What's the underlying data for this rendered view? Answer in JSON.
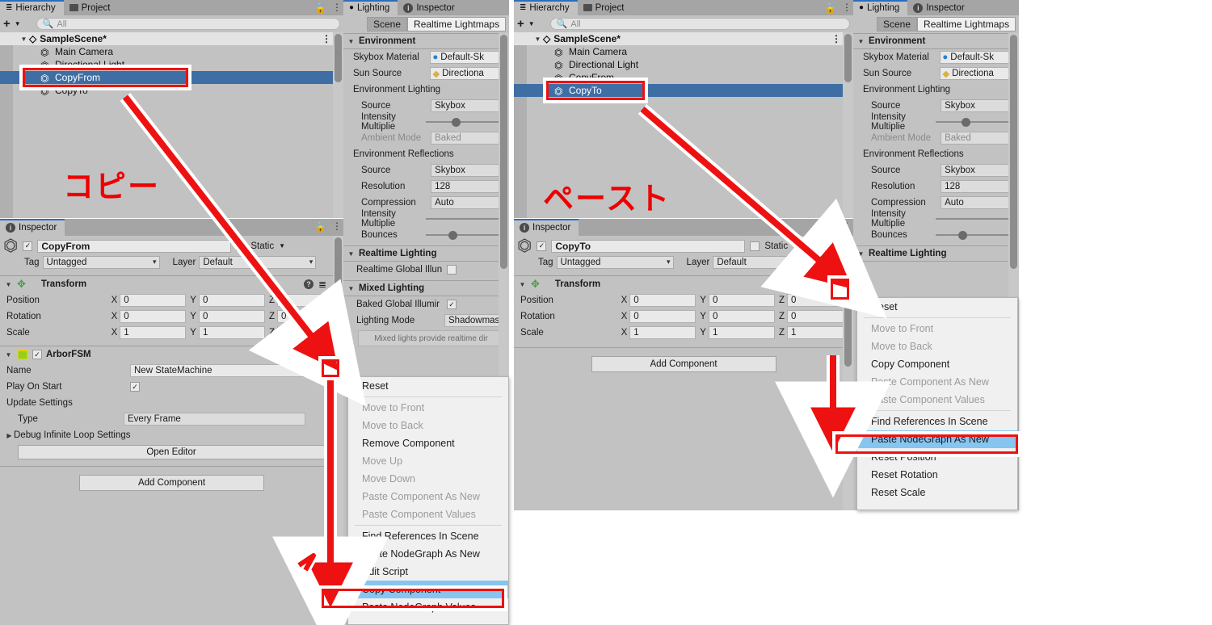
{
  "annotations": {
    "copy_label": "コピー",
    "paste_label": "ペースト",
    "accent_red": "#ee1111",
    "highlight_blue": "#86c5f0",
    "selection_blue": "#3f6ea5"
  },
  "left": {
    "hierarchy": {
      "tabs": [
        {
          "label": "Hierarchy",
          "icon": "hierarchy-icon",
          "active": true
        },
        {
          "label": "Project",
          "icon": "folder-icon",
          "active": false
        }
      ],
      "create_label": "+",
      "search_placeholder": "All",
      "search_value": "",
      "scene": "SampleScene*",
      "items": [
        {
          "label": "Main Camera",
          "selected": false
        },
        {
          "label": "Directional Light",
          "selected": false
        },
        {
          "label": "CopyFrom",
          "selected": true
        },
        {
          "label": "CopyTo",
          "selected": false
        }
      ]
    },
    "inspector": {
      "tab_label": "Inspector",
      "object_name": "CopyFrom",
      "enabled": true,
      "static_label": "Static",
      "tag_label": "Tag",
      "tag_value": "Untagged",
      "layer_label": "Layer",
      "layer_value": "Default",
      "transform": {
        "title": "Transform",
        "rows": [
          {
            "label": "Position",
            "x": "0",
            "y": "0",
            "z": "0"
          },
          {
            "label": "Rotation",
            "x": "0",
            "y": "0",
            "z": "0"
          },
          {
            "label": "Scale",
            "x": "1",
            "y": "1",
            "z": "1"
          }
        ]
      },
      "arborfsm": {
        "title": "ArborFSM",
        "enabled": true,
        "name_label": "Name",
        "name_value": "New StateMachine",
        "play_on_start_label": "Play On Start",
        "play_on_start": true,
        "update_settings_label": "Update Settings",
        "type_label": "Type",
        "type_value": "Every Frame",
        "debug_label": "Debug Infinite Loop Settings",
        "open_editor_label": "Open Editor"
      },
      "add_component_label": "Add Component"
    },
    "lighting": {
      "tabs": [
        {
          "label": "Lighting",
          "icon": "bulb-icon",
          "active": true
        },
        {
          "label": "Inspector",
          "icon": "info-icon",
          "active": false
        }
      ],
      "subtabs": [
        {
          "label": "Scene",
          "active": true
        },
        {
          "label": "Realtime Lightmaps",
          "active": false
        }
      ],
      "environment": {
        "title": "Environment",
        "skybox_material_label": "Skybox Material",
        "skybox_material_value": "Default-Sk",
        "sun_source_label": "Sun Source",
        "sun_source_value": "Directiona",
        "env_lighting_label": "Environment Lighting",
        "source_label": "Source",
        "source_value": "Skybox",
        "intensity_label": "Intensity Multiplie",
        "ambient_mode_label": "Ambient Mode",
        "ambient_mode_value": "Baked",
        "env_reflections_label": "Environment Reflections",
        "refl_source_label": "Source",
        "refl_source_value": "Skybox",
        "resolution_label": "Resolution",
        "resolution_value": "128",
        "compression_label": "Compression",
        "compression_value": "Auto",
        "refl_intensity_label": "Intensity Multiplie",
        "bounces_label": "Bounces"
      },
      "realtime": {
        "title": "Realtime Lighting",
        "rtgi_label": "Realtime Global Illun",
        "rtgi_checked": false
      },
      "mixed": {
        "title": "Mixed Lighting",
        "bgi_label": "Baked Global Illumir",
        "bgi_checked": true,
        "mode_label": "Lighting Mode",
        "mode_value": "Shadowmas",
        "help_text": "Mixed lights provide realtime dir"
      }
    },
    "context_menu": {
      "items": [
        {
          "label": "Reset",
          "state": "enabled"
        },
        {
          "label": "",
          "state": "separator"
        },
        {
          "label": "Move to Front",
          "state": "disabled"
        },
        {
          "label": "Move to Back",
          "state": "disabled"
        },
        {
          "label": "Remove Component",
          "state": "enabled"
        },
        {
          "label": "Move Up",
          "state": "disabled"
        },
        {
          "label": "Move Down",
          "state": "disabled"
        },
        {
          "label": "Paste Component As New",
          "state": "disabled"
        },
        {
          "label": "Paste Component Values",
          "state": "disabled"
        },
        {
          "label": "",
          "state": "separator"
        },
        {
          "label": "Find References In Scene",
          "state": "enabled"
        },
        {
          "label": "Paste NodeGraph As New",
          "state": "enabled"
        },
        {
          "label": "Edit Script",
          "state": "enabled"
        },
        {
          "label": "Copy Component",
          "state": "highlighted"
        },
        {
          "label": "Paste NodeGraph Values",
          "state": "enabled"
        }
      ]
    }
  },
  "right": {
    "hierarchy": {
      "tabs": [
        {
          "label": "Hierarchy",
          "icon": "hierarchy-icon",
          "active": true
        },
        {
          "label": "Project",
          "icon": "folder-icon",
          "active": false
        }
      ],
      "create_label": "+",
      "search_placeholder": "All",
      "search_value": "",
      "scene": "SampleScene*",
      "items": [
        {
          "label": "Main Camera",
          "selected": false
        },
        {
          "label": "Directional Light",
          "selected": false
        },
        {
          "label": "CopyFrom",
          "selected": false
        },
        {
          "label": "CopyTo",
          "selected": true
        }
      ]
    },
    "inspector": {
      "tab_label": "Inspector",
      "object_name": "CopyTo",
      "enabled": true,
      "static_label": "Static",
      "tag_label": "Tag",
      "tag_value": "Untagged",
      "layer_label": "Layer",
      "layer_value": "Default",
      "transform": {
        "title": "Transform",
        "rows": [
          {
            "label": "Position",
            "x": "0",
            "y": "0",
            "z": "0"
          },
          {
            "label": "Rotation",
            "x": "0",
            "y": "0",
            "z": "0"
          },
          {
            "label": "Scale",
            "x": "1",
            "y": "1",
            "z": "1"
          }
        ]
      },
      "add_component_label": "Add Component"
    },
    "lighting": {
      "tabs": [
        {
          "label": "Lighting",
          "icon": "bulb-icon",
          "active": true
        },
        {
          "label": "Inspector",
          "icon": "info-icon",
          "active": false
        }
      ],
      "subtabs": [
        {
          "label": "Scene",
          "active": true
        },
        {
          "label": "Realtime Lightmaps",
          "active": false
        }
      ],
      "environment": {
        "title": "Environment",
        "skybox_material_label": "Skybox Material",
        "skybox_material_value": "Default-Sk",
        "sun_source_label": "Sun Source",
        "sun_source_value": "Directiona",
        "env_lighting_label": "Environment Lighting",
        "source_label": "Source",
        "source_value": "Skybox",
        "intensity_label": "Intensity Multiplie",
        "ambient_mode_label": "Ambient Mode",
        "ambient_mode_value": "Baked",
        "env_reflections_label": "Environment Reflections",
        "refl_source_label": "Source",
        "refl_source_value": "Skybox",
        "resolution_label": "Resolution",
        "resolution_value": "128",
        "compression_label": "Compression",
        "compression_value": "Auto",
        "refl_intensity_label": "Intensity Multiplie",
        "bounces_label": "Bounces"
      },
      "realtime": {
        "title": "Realtime Lighting"
      }
    },
    "context_menu": {
      "items": [
        {
          "label": "Reset",
          "state": "enabled"
        },
        {
          "label": "",
          "state": "separator"
        },
        {
          "label": "Move to Front",
          "state": "disabled"
        },
        {
          "label": "Move to Back",
          "state": "disabled"
        },
        {
          "label": "Copy Component",
          "state": "enabled"
        },
        {
          "label": "Paste Component As New",
          "state": "disabled"
        },
        {
          "label": "Paste Component Values",
          "state": "disabled"
        },
        {
          "label": "",
          "state": "separator"
        },
        {
          "label": "Find References In Scene",
          "state": "enabled"
        },
        {
          "label": "Paste NodeGraph As New",
          "state": "highlighted"
        },
        {
          "label": "Reset Position",
          "state": "enabled"
        },
        {
          "label": "Reset Rotation",
          "state": "enabled"
        },
        {
          "label": "Reset Scale",
          "state": "enabled"
        }
      ]
    }
  }
}
